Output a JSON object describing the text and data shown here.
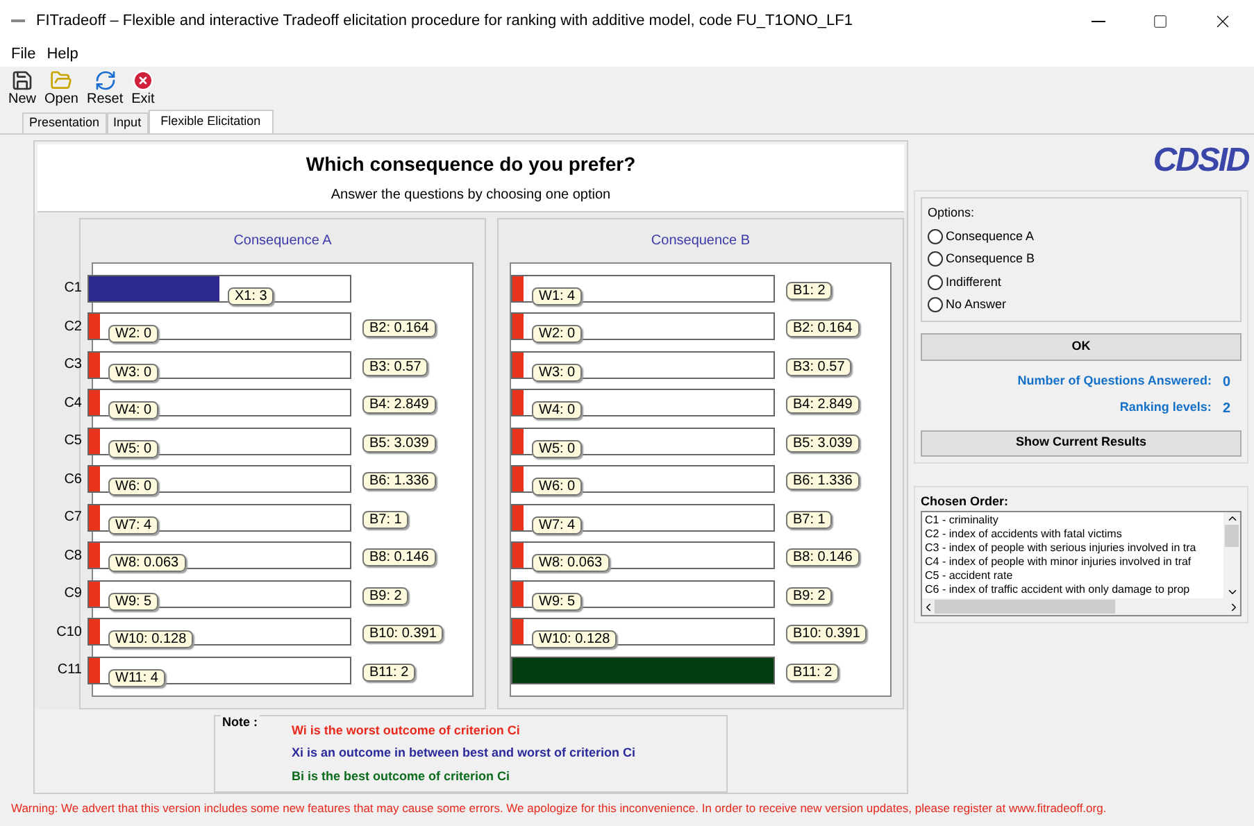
{
  "window": {
    "title": "FITradeoff – Flexible and interactive Tradeoff elicitation procedure for ranking with additive model, code FU_T1ONO_LF1"
  },
  "menu": [
    "File",
    "Help"
  ],
  "toolbar": [
    {
      "label": "New",
      "kind": "new"
    },
    {
      "label": "Open",
      "kind": "open"
    },
    {
      "label": "Reset",
      "kind": "reset"
    },
    {
      "label": "Exit",
      "kind": "exit"
    }
  ],
  "tabs": [
    {
      "label": "Presentation",
      "selected": false
    },
    {
      "label": "Input",
      "selected": false
    },
    {
      "label": "Flexible Elicitation",
      "selected": true
    }
  ],
  "question": {
    "title": "Which consequence do you prefer?",
    "subtitle": "Answer the questions by choosing one option"
  },
  "logo": "CDSID",
  "consequences": [
    {
      "title": "Consequence A",
      "rows": [
        {
          "criterion": "C1",
          "kind": "between",
          "level": 0.5,
          "tag": "X1: 3"
        },
        {
          "criterion": "C2",
          "kind": "worst",
          "level": 0.04,
          "tag": "W2: 0",
          "best": "B2: 0.164"
        },
        {
          "criterion": "C3",
          "kind": "worst",
          "level": 0.04,
          "tag": "W3: 0",
          "best": "B3: 0.57"
        },
        {
          "criterion": "C4",
          "kind": "worst",
          "level": 0.04,
          "tag": "W4: 0",
          "best": "B4: 2.849"
        },
        {
          "criterion": "C5",
          "kind": "worst",
          "level": 0.04,
          "tag": "W5: 0",
          "best": "B5: 3.039"
        },
        {
          "criterion": "C6",
          "kind": "worst",
          "level": 0.04,
          "tag": "W6: 0",
          "best": "B6: 1.336"
        },
        {
          "criterion": "C7",
          "kind": "worst",
          "level": 0.04,
          "tag": "W7: 4",
          "best": "B7: 1"
        },
        {
          "criterion": "C8",
          "kind": "worst",
          "level": 0.04,
          "tag": "W8: 0.063",
          "best": "B8: 0.146"
        },
        {
          "criterion": "C9",
          "kind": "worst",
          "level": 0.04,
          "tag": "W9: 5",
          "best": "B9: 2"
        },
        {
          "criterion": "C10",
          "kind": "worst",
          "level": 0.04,
          "tag": "W10: 0.128",
          "best": "B10: 0.391"
        },
        {
          "criterion": "C11",
          "kind": "worst",
          "level": 0.04,
          "tag": "W11: 4",
          "best": "B11: 2"
        }
      ]
    },
    {
      "title": "Consequence B",
      "rows": [
        {
          "kind": "worst",
          "level": 0.04,
          "tag": "W1: 4",
          "best": "B1: 2"
        },
        {
          "kind": "worst",
          "level": 0.04,
          "tag": "W2: 0",
          "best": "B2: 0.164"
        },
        {
          "kind": "worst",
          "level": 0.04,
          "tag": "W3: 0",
          "best": "B3: 0.57"
        },
        {
          "kind": "worst",
          "level": 0.04,
          "tag": "W4: 0",
          "best": "B4: 2.849"
        },
        {
          "kind": "worst",
          "level": 0.04,
          "tag": "W5: 0",
          "best": "B5: 3.039"
        },
        {
          "kind": "worst",
          "level": 0.04,
          "tag": "W6: 0",
          "best": "B6: 1.336"
        },
        {
          "kind": "worst",
          "level": 0.04,
          "tag": "W7: 4",
          "best": "B7: 1"
        },
        {
          "kind": "worst",
          "level": 0.04,
          "tag": "W8: 0.063",
          "best": "B8: 0.146"
        },
        {
          "kind": "worst",
          "level": 0.04,
          "tag": "W9: 5",
          "best": "B9: 2"
        },
        {
          "kind": "worst",
          "level": 0.04,
          "tag": "W10: 0.128",
          "best": "B10: 0.391"
        },
        {
          "kind": "best",
          "level": 1,
          "best": "B11: 2"
        }
      ]
    }
  ],
  "note": {
    "label": "Note :",
    "lines": [
      {
        "text": "Wi is the worst outcome of criterion Ci",
        "color": "#e8291c"
      },
      {
        "text": "Xi is an outcome in between best and worst of criterion Ci",
        "color": "#2b2a9b"
      },
      {
        "text": "Bi is the best outcome of criterion Ci",
        "color": "#0b6b1c"
      }
    ]
  },
  "warning": "Warning: We advert that this version includes some new features that may cause some errors. We apologize for this inconvenience. In order to receive new version updates, please register at www.fitradeoff.org.",
  "options": {
    "label": "Options:",
    "items": [
      {
        "label": "Consequence A",
        "selected": false
      },
      {
        "label": "Consequence B",
        "selected": false
      },
      {
        "label": "Indifferent",
        "selected": false
      },
      {
        "label": "No Answer",
        "selected": false
      }
    ]
  },
  "ok_button": "OK",
  "stats": [
    {
      "label": "Number of Questions Answered:",
      "value": "0"
    },
    {
      "label": "Ranking levels:",
      "value": "2"
    }
  ],
  "results_button": "Show Current Results",
  "chosen_order": {
    "label": "Chosen Order:",
    "items": [
      "C1 - criminality",
      "C2 - index of accidents with fatal victims",
      "C3 - index of people with serious injuries involved in tra",
      "C4 - index of people with minor injuries involved in traf",
      "C5 - accident rate",
      "C6 - index of traffic accident with only damage to prop"
    ]
  }
}
